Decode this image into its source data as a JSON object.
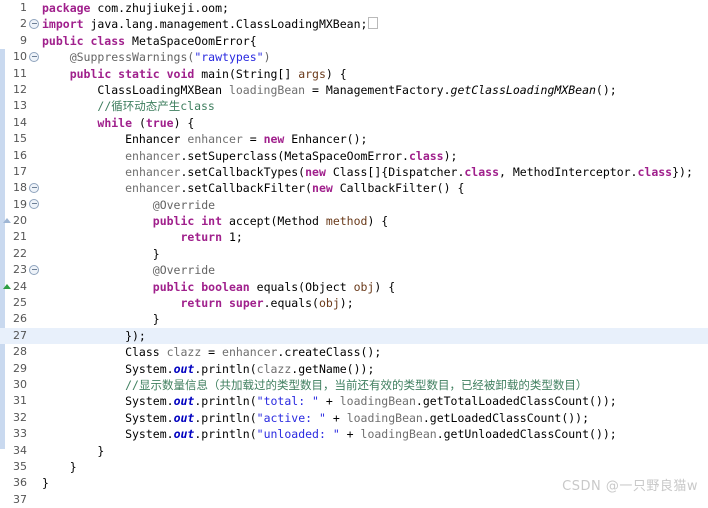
{
  "editor": {
    "language": "Java",
    "package": "com.zhujiukeji.oom",
    "class_name": "MetaSpaceOomError",
    "current_line": 27,
    "first_line": 1,
    "last_line": 37,
    "colors": {
      "background": "#ffffff",
      "keyword": "#a0208c",
      "string": "#2a2ae0",
      "comment": "#3f7f5f",
      "annotation": "#646464",
      "static_field": "#0000c0",
      "local_var": "#6f6f6f",
      "current_line_highlight": "#e8f0fb",
      "change_bar": "#c9d9ef",
      "gutter_text": "#555555"
    }
  },
  "watermark": {
    "text": "CSDN @一只野良猫w"
  },
  "lines": [
    {
      "num": "1",
      "marker": "none",
      "current": false,
      "tokens": [
        {
          "t": "kw",
          "v": "package"
        },
        {
          "t": "plain",
          "v": " com.zhujiukeji.oom;"
        }
      ]
    },
    {
      "num": "2",
      "marker": "fold",
      "current": false,
      "tokens": [
        {
          "t": "kw",
          "v": "import"
        },
        {
          "t": "plain",
          "v": " java.lang.management.ClassLoadingMXBean;"
        },
        {
          "t": "foldbox",
          "v": ""
        }
      ]
    },
    {
      "num": "9",
      "marker": "none",
      "current": false,
      "tokens": [
        {
          "t": "kw",
          "v": "public class"
        },
        {
          "t": "plain",
          "v": " MetaSpaceOomError{"
        }
      ]
    },
    {
      "num": "10",
      "marker": "fold",
      "current": false,
      "tokens": [
        {
          "t": "plain",
          "v": "    "
        },
        {
          "t": "anno",
          "v": "@SuppressWarnings("
        },
        {
          "t": "str",
          "v": "\"rawtypes\""
        },
        {
          "t": "anno",
          "v": ")"
        }
      ]
    },
    {
      "num": "11",
      "marker": "none",
      "current": false,
      "tokens": [
        {
          "t": "plain",
          "v": "    "
        },
        {
          "t": "kw",
          "v": "public static void"
        },
        {
          "t": "plain",
          "v": " main(String[] "
        },
        {
          "t": "param",
          "v": "args"
        },
        {
          "t": "plain",
          "v": ") {"
        }
      ]
    },
    {
      "num": "12",
      "marker": "none",
      "current": false,
      "tokens": [
        {
          "t": "plain",
          "v": "        ClassLoadingMXBean "
        },
        {
          "t": "local",
          "v": "loadingBean"
        },
        {
          "t": "plain",
          "v": " = ManagementFactory."
        },
        {
          "t": "stat",
          "v": "getClassLoadingMXBean"
        },
        {
          "t": "plain",
          "v": "();"
        }
      ]
    },
    {
      "num": "13",
      "marker": "none",
      "current": false,
      "tokens": [
        {
          "t": "plain",
          "v": "        "
        },
        {
          "t": "cmt",
          "v": "//循环动态产生class"
        }
      ]
    },
    {
      "num": "14",
      "marker": "none",
      "current": false,
      "tokens": [
        {
          "t": "plain",
          "v": "        "
        },
        {
          "t": "kw",
          "v": "while"
        },
        {
          "t": "plain",
          "v": " ("
        },
        {
          "t": "kw",
          "v": "true"
        },
        {
          "t": "plain",
          "v": ") {"
        }
      ]
    },
    {
      "num": "15",
      "marker": "none",
      "current": false,
      "tokens": [
        {
          "t": "plain",
          "v": "            Enhancer "
        },
        {
          "t": "local",
          "v": "enhancer"
        },
        {
          "t": "plain",
          "v": " = "
        },
        {
          "t": "kw",
          "v": "new"
        },
        {
          "t": "plain",
          "v": " Enhancer();"
        }
      ]
    },
    {
      "num": "16",
      "marker": "none",
      "current": false,
      "tokens": [
        {
          "t": "plain",
          "v": "            "
        },
        {
          "t": "local",
          "v": "enhancer"
        },
        {
          "t": "plain",
          "v": ".setSuperclass(MetaSpaceOomError."
        },
        {
          "t": "kw",
          "v": "class"
        },
        {
          "t": "plain",
          "v": ");"
        }
      ]
    },
    {
      "num": "17",
      "marker": "none",
      "current": false,
      "tokens": [
        {
          "t": "plain",
          "v": "            "
        },
        {
          "t": "local",
          "v": "enhancer"
        },
        {
          "t": "plain",
          "v": ".setCallbackTypes("
        },
        {
          "t": "kw",
          "v": "new"
        },
        {
          "t": "plain",
          "v": " Class[]{Dispatcher."
        },
        {
          "t": "kw",
          "v": "class"
        },
        {
          "t": "plain",
          "v": ", MethodInterceptor."
        },
        {
          "t": "kw",
          "v": "class"
        },
        {
          "t": "plain",
          "v": "});"
        }
      ]
    },
    {
      "num": "18",
      "marker": "fold",
      "current": false,
      "tokens": [
        {
          "t": "plain",
          "v": "            "
        },
        {
          "t": "local",
          "v": "enhancer"
        },
        {
          "t": "plain",
          "v": ".setCallbackFilter("
        },
        {
          "t": "kw",
          "v": "new"
        },
        {
          "t": "plain",
          "v": " CallbackFilter() {"
        }
      ]
    },
    {
      "num": "19",
      "marker": "fold",
      "current": false,
      "tokens": [
        {
          "t": "plain",
          "v": "                "
        },
        {
          "t": "anno",
          "v": "@Override"
        }
      ]
    },
    {
      "num": "20",
      "marker": "tri-blue",
      "current": false,
      "tokens": [
        {
          "t": "plain",
          "v": "                "
        },
        {
          "t": "kw",
          "v": "public int"
        },
        {
          "t": "plain",
          "v": " accept(Method "
        },
        {
          "t": "param",
          "v": "method"
        },
        {
          "t": "plain",
          "v": ") {"
        }
      ]
    },
    {
      "num": "21",
      "marker": "none",
      "current": false,
      "tokens": [
        {
          "t": "plain",
          "v": "                    "
        },
        {
          "t": "kw",
          "v": "return"
        },
        {
          "t": "plain",
          "v": " 1;"
        }
      ]
    },
    {
      "num": "22",
      "marker": "none",
      "current": false,
      "tokens": [
        {
          "t": "plain",
          "v": "                }"
        }
      ]
    },
    {
      "num": "23",
      "marker": "fold",
      "current": false,
      "tokens": [
        {
          "t": "plain",
          "v": "                "
        },
        {
          "t": "anno",
          "v": "@Override"
        }
      ]
    },
    {
      "num": "24",
      "marker": "tri-green",
      "current": false,
      "tokens": [
        {
          "t": "plain",
          "v": "                "
        },
        {
          "t": "kw",
          "v": "public boolean"
        },
        {
          "t": "plain",
          "v": " equals(Object "
        },
        {
          "t": "param",
          "v": "obj"
        },
        {
          "t": "plain",
          "v": ") {"
        }
      ]
    },
    {
      "num": "25",
      "marker": "none",
      "current": false,
      "tokens": [
        {
          "t": "plain",
          "v": "                    "
        },
        {
          "t": "kw",
          "v": "return"
        },
        {
          "t": "plain",
          "v": " "
        },
        {
          "t": "kw",
          "v": "super"
        },
        {
          "t": "plain",
          "v": ".equals("
        },
        {
          "t": "param",
          "v": "obj"
        },
        {
          "t": "plain",
          "v": ");"
        }
      ]
    },
    {
      "num": "26",
      "marker": "none",
      "current": false,
      "tokens": [
        {
          "t": "plain",
          "v": "                }"
        }
      ]
    },
    {
      "num": "27",
      "marker": "none",
      "current": true,
      "tokens": [
        {
          "t": "plain",
          "v": "            });"
        }
      ]
    },
    {
      "num": "28",
      "marker": "none",
      "current": false,
      "tokens": [
        {
          "t": "plain",
          "v": "            Class "
        },
        {
          "t": "local",
          "v": "clazz"
        },
        {
          "t": "plain",
          "v": " = "
        },
        {
          "t": "local",
          "v": "enhancer"
        },
        {
          "t": "plain",
          "v": ".createClass();"
        }
      ]
    },
    {
      "num": "29",
      "marker": "none",
      "current": false,
      "tokens": [
        {
          "t": "plain",
          "v": "            System."
        },
        {
          "t": "field",
          "v": "out"
        },
        {
          "t": "plain",
          "v": ".println("
        },
        {
          "t": "local",
          "v": "clazz"
        },
        {
          "t": "plain",
          "v": ".getName());"
        }
      ]
    },
    {
      "num": "30",
      "marker": "none",
      "current": false,
      "tokens": [
        {
          "t": "plain",
          "v": "            "
        },
        {
          "t": "cmt",
          "v": "//显示数量信息（共加载过的类型数目，当前还有效的类型数目，已经被卸载的类型数目）"
        }
      ]
    },
    {
      "num": "31",
      "marker": "none",
      "current": false,
      "tokens": [
        {
          "t": "plain",
          "v": "            System."
        },
        {
          "t": "field",
          "v": "out"
        },
        {
          "t": "plain",
          "v": ".println("
        },
        {
          "t": "str",
          "v": "\"total: \""
        },
        {
          "t": "plain",
          "v": " + "
        },
        {
          "t": "local",
          "v": "loadingBean"
        },
        {
          "t": "plain",
          "v": ".getTotalLoadedClassCount());"
        }
      ]
    },
    {
      "num": "32",
      "marker": "none",
      "current": false,
      "tokens": [
        {
          "t": "plain",
          "v": "            System."
        },
        {
          "t": "field",
          "v": "out"
        },
        {
          "t": "plain",
          "v": ".println("
        },
        {
          "t": "str",
          "v": "\"active: \""
        },
        {
          "t": "plain",
          "v": " + "
        },
        {
          "t": "local",
          "v": "loadingBean"
        },
        {
          "t": "plain",
          "v": ".getLoadedClassCount());"
        }
      ]
    },
    {
      "num": "33",
      "marker": "none",
      "current": false,
      "tokens": [
        {
          "t": "plain",
          "v": "            System."
        },
        {
          "t": "field",
          "v": "out"
        },
        {
          "t": "plain",
          "v": ".println("
        },
        {
          "t": "str",
          "v": "\"unloaded: \""
        },
        {
          "t": "plain",
          "v": " + "
        },
        {
          "t": "local",
          "v": "loadingBean"
        },
        {
          "t": "plain",
          "v": ".getUnloadedClassCount());"
        }
      ]
    },
    {
      "num": "34",
      "marker": "none",
      "current": false,
      "tokens": [
        {
          "t": "plain",
          "v": "        }"
        }
      ]
    },
    {
      "num": "35",
      "marker": "none",
      "current": false,
      "tokens": [
        {
          "t": "plain",
          "v": "    }"
        }
      ]
    },
    {
      "num": "36",
      "marker": "none",
      "current": false,
      "tokens": [
        {
          "t": "plain",
          "v": "}"
        }
      ]
    },
    {
      "num": "37",
      "marker": "none",
      "current": false,
      "tokens": [
        {
          "t": "plain",
          "v": ""
        }
      ]
    }
  ]
}
